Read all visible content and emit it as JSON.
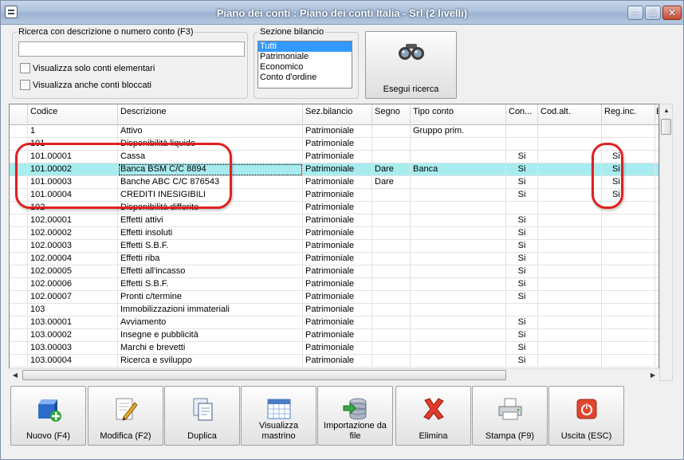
{
  "window": {
    "title": "Piano dei conti : Piano dei conti Italia - Srl (2 livelli)"
  },
  "search": {
    "legend": "Ricerca con descrizione o numero conto (F3)",
    "value": "",
    "placeholder": "",
    "chk_elementari": "Visualizza solo conti elementari",
    "chk_bloccati": "Visualizza anche conti bloccati"
  },
  "sezione": {
    "legend": "Sezione bilancio",
    "options": [
      "Tutti",
      "Patrimoniale",
      "Economico",
      "Conto d'ordine"
    ],
    "selected": "Tutti"
  },
  "search_button": {
    "label": "Esegui ricerca",
    "icon": "binoculars-icon"
  },
  "grid": {
    "columns": [
      "Codice",
      "Descrizione",
      "Sez.bilancio",
      "Segno",
      "Tipo conto",
      "Con...",
      "Cod.alt.",
      "Reg.inc.",
      "E"
    ],
    "rows": [
      {
        "codice": "1",
        "descrizione": "Attivo",
        "sez": "Patrimoniale",
        "segno": "",
        "tipo": "Gruppo prim.",
        "con": "",
        "codalt": "",
        "reginc": ""
      },
      {
        "codice": "101",
        "descrizione": "Disponibilità liquide",
        "sez": "Patrimoniale",
        "segno": "",
        "tipo": "",
        "con": "",
        "codalt": "",
        "reginc": ""
      },
      {
        "codice": "101.00001",
        "descrizione": "Cassa",
        "sez": "Patrimoniale",
        "segno": "",
        "tipo": "",
        "con": "Si",
        "codalt": "",
        "reginc": "Si"
      },
      {
        "codice": "101.00002",
        "descrizione": "Banca BSM C/C 8894",
        "sez": "Patrimoniale",
        "segno": "Dare",
        "tipo": "Banca",
        "con": "Si",
        "codalt": "",
        "reginc": "Si",
        "extra": "I"
      },
      {
        "codice": "101.00003",
        "descrizione": "Banche ABC C/C 876543",
        "sez": "Patrimoniale",
        "segno": "Dare",
        "tipo": "",
        "con": "Si",
        "codalt": "",
        "reginc": "Si"
      },
      {
        "codice": "101.00004",
        "descrizione": "CREDITI INESIGIBILI",
        "sez": "Patrimoniale",
        "segno": "",
        "tipo": "",
        "con": "Si",
        "codalt": "",
        "reginc": "Si"
      },
      {
        "codice": "102",
        "descrizione": "Disponibilità differite",
        "sez": "Patrimoniale",
        "segno": "",
        "tipo": "",
        "con": "",
        "codalt": "",
        "reginc": ""
      },
      {
        "codice": "102.00001",
        "descrizione": "Effetti attivi",
        "sez": "Patrimoniale",
        "segno": "",
        "tipo": "",
        "con": "Si",
        "codalt": "",
        "reginc": ""
      },
      {
        "codice": "102.00002",
        "descrizione": "Effetti insoluti",
        "sez": "Patrimoniale",
        "segno": "",
        "tipo": "",
        "con": "Si",
        "codalt": "",
        "reginc": ""
      },
      {
        "codice": "102.00003",
        "descrizione": "Effetti S.B.F.",
        "sez": "Patrimoniale",
        "segno": "",
        "tipo": "",
        "con": "Si",
        "codalt": "",
        "reginc": ""
      },
      {
        "codice": "102.00004",
        "descrizione": "Effetti riba",
        "sez": "Patrimoniale",
        "segno": "",
        "tipo": "",
        "con": "Si",
        "codalt": "",
        "reginc": ""
      },
      {
        "codice": "102.00005",
        "descrizione": "Effetti all'incasso",
        "sez": "Patrimoniale",
        "segno": "",
        "tipo": "",
        "con": "Si",
        "codalt": "",
        "reginc": ""
      },
      {
        "codice": "102.00006",
        "descrizione": "Effetti S.B.F.",
        "sez": "Patrimoniale",
        "segno": "",
        "tipo": "",
        "con": "Si",
        "codalt": "",
        "reginc": ""
      },
      {
        "codice": "102.00007",
        "descrizione": "Pronti c/termine",
        "sez": "Patrimoniale",
        "segno": "",
        "tipo": "",
        "con": "Si",
        "codalt": "",
        "reginc": ""
      },
      {
        "codice": "103",
        "descrizione": "Immobilizzazioni immateriali",
        "sez": "Patrimoniale",
        "segno": "",
        "tipo": "",
        "con": "",
        "codalt": "",
        "reginc": ""
      },
      {
        "codice": "103.00001",
        "descrizione": "Avviamento",
        "sez": "Patrimoniale",
        "segno": "",
        "tipo": "",
        "con": "Si",
        "codalt": "",
        "reginc": ""
      },
      {
        "codice": "103.00002",
        "descrizione": "Insegne e pubblicità",
        "sez": "Patrimoniale",
        "segno": "",
        "tipo": "",
        "con": "Si",
        "codalt": "",
        "reginc": ""
      },
      {
        "codice": "103.00003",
        "descrizione": "Marchi e brevetti",
        "sez": "Patrimoniale",
        "segno": "",
        "tipo": "",
        "con": "Si",
        "codalt": "",
        "reginc": ""
      },
      {
        "codice": "103.00004",
        "descrizione": "Ricerca e sviluppo",
        "sez": "Patrimoniale",
        "segno": "",
        "tipo": "",
        "con": "Si",
        "codalt": "",
        "reginc": ""
      }
    ]
  },
  "toolbar": {
    "nuovo": "Nuovo (F4)",
    "modifica": "Modifica (F2)",
    "duplica": "Duplica",
    "mastrino": "Visualizza mastrino",
    "importazione": "Importazione da file",
    "elimina": "Elimina",
    "stampa": "Stampa (F9)",
    "uscita": "Uscita (ESC)"
  },
  "colors": {
    "selected_row": "#a8ecef",
    "annotation": "#e02020",
    "list_selection": "#3399ff"
  }
}
